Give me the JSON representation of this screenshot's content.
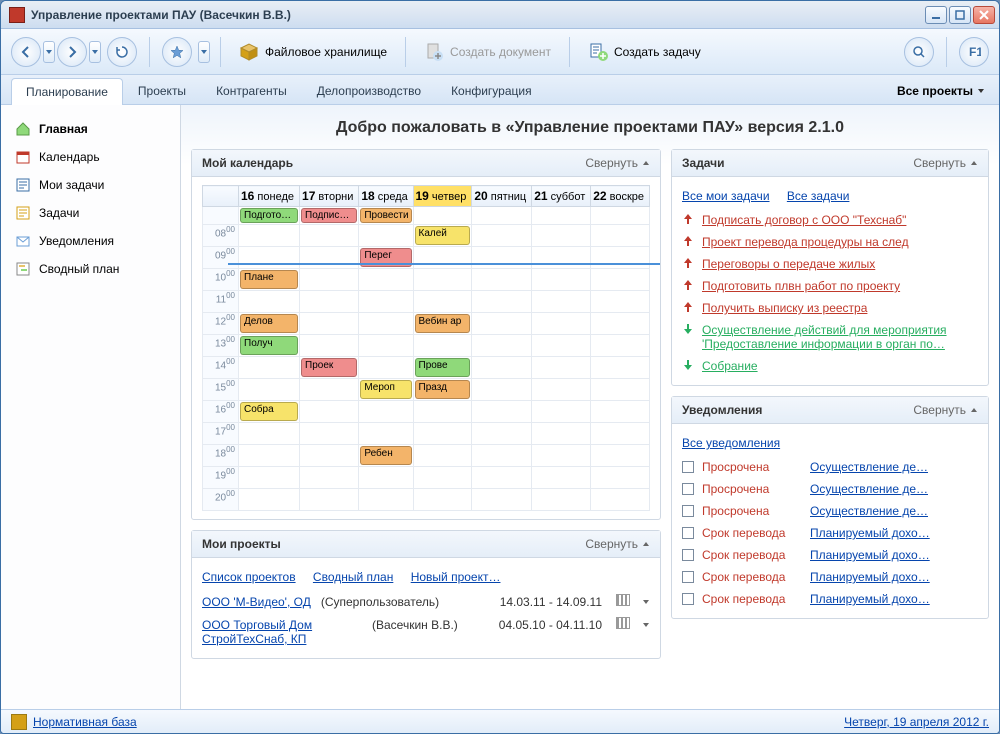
{
  "window": {
    "title": "Управление проектами ПАУ (Васечкин В.В.)"
  },
  "toolbar": {
    "file_repo": "Файловое хранилище",
    "create_doc": "Создать документ",
    "create_task": "Создать задачу"
  },
  "tabs": {
    "items": [
      "Планирование",
      "Проекты",
      "Контрагенты",
      "Делопроизводство",
      "Конфигурация"
    ],
    "all_projects": "Все проекты"
  },
  "sidebar": {
    "items": [
      {
        "label": "Главная",
        "icon": "home"
      },
      {
        "label": "Календарь",
        "icon": "calendar"
      },
      {
        "label": "Мои задачи",
        "icon": "mytasks"
      },
      {
        "label": "Задачи",
        "icon": "tasks"
      },
      {
        "label": "Уведомления",
        "icon": "notif"
      },
      {
        "label": "Сводный план",
        "icon": "plan"
      }
    ]
  },
  "welcome": "Добро пожаловать в «Управление проектами ПАУ» версия 2.1.0",
  "collapse_label": "Свернуть",
  "calendar": {
    "title": "Мой календарь",
    "days": [
      {
        "num": "16",
        "dow": "понеде"
      },
      {
        "num": "17",
        "dow": "вторни"
      },
      {
        "num": "18",
        "dow": "среда"
      },
      {
        "num": "19",
        "dow": "четвер",
        "today": true
      },
      {
        "num": "20",
        "dow": "пятниц"
      },
      {
        "num": "21",
        "dow": "суббот"
      },
      {
        "num": "22",
        "dow": "воскре"
      }
    ],
    "hours": [
      "08",
      "09",
      "10",
      "11",
      "12",
      "13",
      "14",
      "15",
      "16",
      "17",
      "18",
      "19",
      "20"
    ],
    "allday": [
      {
        "day": 0,
        "text": "Подгото…",
        "color": "green"
      },
      {
        "day": 1,
        "text": "Подпис…",
        "color": "red"
      },
      {
        "day": 2,
        "text": "Провести",
        "color": "orange"
      }
    ],
    "events": [
      {
        "day": 3,
        "hour": "08",
        "text": "Калей",
        "color": "yellow"
      },
      {
        "day": 2,
        "hour": "09",
        "text": "Перег",
        "color": "red"
      },
      {
        "day": 0,
        "hour": "10",
        "text": "Плане",
        "color": "orange"
      },
      {
        "day": 0,
        "hour": "12",
        "text": "Делов",
        "color": "orange"
      },
      {
        "day": 3,
        "hour": "12",
        "text": "Вебин ар",
        "color": "orange"
      },
      {
        "day": 0,
        "hour": "13",
        "text": "Получ",
        "color": "green"
      },
      {
        "day": 1,
        "hour": "14",
        "text": "Проек",
        "color": "red"
      },
      {
        "day": 3,
        "hour": "14",
        "text": "Прове",
        "color": "green"
      },
      {
        "day": 2,
        "hour": "15",
        "text": "Мероп",
        "color": "yellow"
      },
      {
        "day": 3,
        "hour": "15",
        "text": "Празд",
        "color": "orange"
      },
      {
        "day": 0,
        "hour": "16",
        "text": "Собра",
        "color": "yellow"
      },
      {
        "day": 2,
        "hour": "18",
        "text": "Ребен",
        "color": "orange"
      }
    ]
  },
  "projects": {
    "title": "Мои проекты",
    "links": {
      "list": "Список проектов",
      "plan": "Сводный план",
      "new": "Новый проект…"
    },
    "rows": [
      {
        "name": "ООО 'М-Видео', ОД",
        "owner": "(Суперпользователь)",
        "dates": "14.03.11 - 14.09.11"
      },
      {
        "name": "ООО Торговый Дом СтройТехСнаб, КП",
        "owner": "(Васечкин В.В.)",
        "dates": "04.05.10 - 04.11.10"
      }
    ]
  },
  "tasks": {
    "title": "Задачи",
    "links": {
      "mine": "Все мои задачи",
      "all": "Все задачи"
    },
    "items": [
      {
        "dir": "up",
        "text": "Подписать договор с ООО \"Техснаб\""
      },
      {
        "dir": "up",
        "text": "Проект перевода процедуры на след"
      },
      {
        "dir": "up",
        "text": "Переговоры о передаче жилых"
      },
      {
        "dir": "up",
        "text": "Подготовить плвн работ по проекту"
      },
      {
        "dir": "up",
        "text": "Получить выписку из реестра"
      },
      {
        "dir": "down",
        "text": "Осуществление действий для мероприятия 'Предоставление информации в орган по…"
      },
      {
        "dir": "down",
        "text": "Собрание"
      }
    ]
  },
  "notifs": {
    "title": "Уведомления",
    "link_all": "Все уведомления",
    "items": [
      {
        "status": "Просрочена",
        "text": "Осуществление де…"
      },
      {
        "status": "Просрочена",
        "text": "Осуществление де…"
      },
      {
        "status": "Просрочена",
        "text": "Осуществление де…"
      },
      {
        "status": "Срок перевода",
        "text": "Планируемый дохо…"
      },
      {
        "status": "Срок перевода",
        "text": "Планируемый дохо…"
      },
      {
        "status": "Срок перевода",
        "text": "Планируемый дохо…"
      },
      {
        "status": "Срок перевода",
        "text": "Планируемый дохо…"
      }
    ]
  },
  "statusbar": {
    "left": "Нормативная база",
    "right": "Четверг, 19 апреля 2012 г."
  }
}
